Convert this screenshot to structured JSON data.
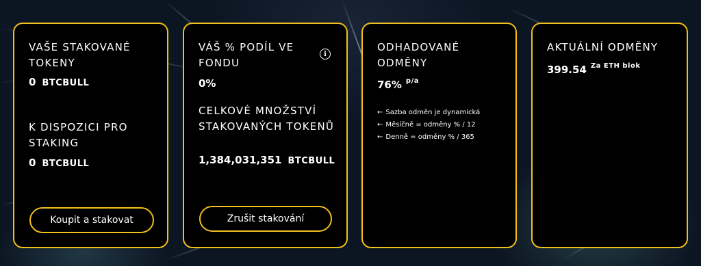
{
  "cards": [
    {
      "staked_label": "VAŠE STAKOVANÉ TOKENY",
      "staked_value": "0",
      "staked_unit": "BTCBULL",
      "available_label": "K DISPOZICI PRO STAKING",
      "available_value": "0",
      "available_unit": "BTCBULL",
      "button_label": "Koupit a stakovat"
    },
    {
      "share_label": "VÁŠ % PODÍL VE FONDU",
      "share_value": "0%",
      "info_icon": "info-icon",
      "total_label": "CELKOVÉ MNOŽSTVÍ STAKOVANÝCH TOKENŮ",
      "total_value": "1,384,031,351",
      "total_unit": "BTCBULL",
      "button_label": "Zrušit stakování"
    },
    {
      "title": "ODHADOVANÉ ODMĚNY",
      "value": "76%",
      "suffix": "p/a",
      "notes": [
        "Sazba odměn je dynamická",
        "Měsíčně = odměny % / 12",
        "Denně = odměny % / 365"
      ],
      "note_icon": "arrow-left-icon"
    },
    {
      "title": "AKTUÁLNÍ ODMĚNY",
      "value": "399.54",
      "suffix": "Za ETH blok"
    }
  ],
  "colors": {
    "accent": "#f2c01d",
    "card_bg": "#000000",
    "text": "#ffffff"
  }
}
